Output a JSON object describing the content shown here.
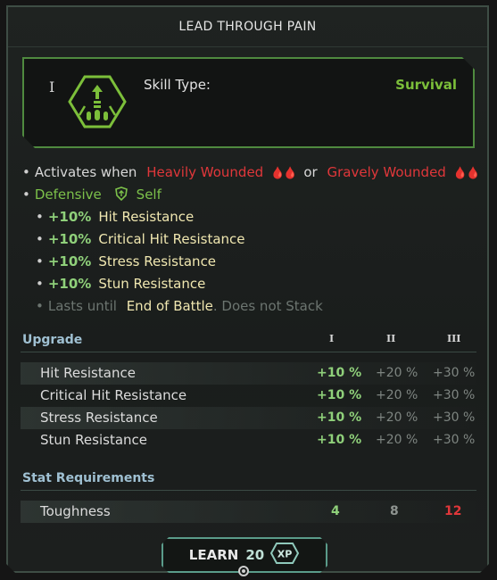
{
  "title": "LEAD THROUGH PAIN",
  "skill": {
    "rank": "I",
    "type_label": "Skill Type:",
    "type_value": "Survival",
    "icon": "survival-skill-icon"
  },
  "effects": {
    "activates_prefix": "Activates when",
    "condition1": "Heavily Wounded",
    "or_text": "or",
    "condition2": "Gravely Wounded",
    "defensive": "Defensive",
    "target": "Self",
    "bonuses": [
      {
        "pct": "+10%",
        "stat": "Hit Resistance"
      },
      {
        "pct": "+10%",
        "stat": "Critical Hit Resistance"
      },
      {
        "pct": "+10%",
        "stat": "Stress Resistance"
      },
      {
        "pct": "+10%",
        "stat": "Stun Resistance"
      }
    ],
    "lasts_prefix": "Lasts until",
    "lasts_value": "End of Battle",
    "stack_note": ". Does not Stack"
  },
  "upgrade": {
    "heading": "Upgrade",
    "tiers": [
      "I",
      "II",
      "III"
    ],
    "rows": [
      {
        "name": "Hit Resistance",
        "v1": "+10 %",
        "v2": "+20 %",
        "v3": "+30 %"
      },
      {
        "name": "Critical Hit Resistance",
        "v1": "+10 %",
        "v2": "+20 %",
        "v3": "+30 %"
      },
      {
        "name": "Stress Resistance",
        "v1": "+10 %",
        "v2": "+20 %",
        "v3": "+30 %"
      },
      {
        "name": "Stun Resistance",
        "v1": "+10 %",
        "v2": "+20 %",
        "v3": "+30 %"
      }
    ]
  },
  "requirements": {
    "heading": "Stat Requirements",
    "rows": [
      {
        "name": "Toughness",
        "v1": "4",
        "v2": "8",
        "v3": "12"
      }
    ]
  },
  "learn": {
    "label": "LEARN",
    "cost": "20",
    "currency": "XP"
  },
  "colors": {
    "accent_green": "#7cc14a",
    "danger_red": "#e0373a",
    "frame_teal": "#5a9b8a"
  }
}
